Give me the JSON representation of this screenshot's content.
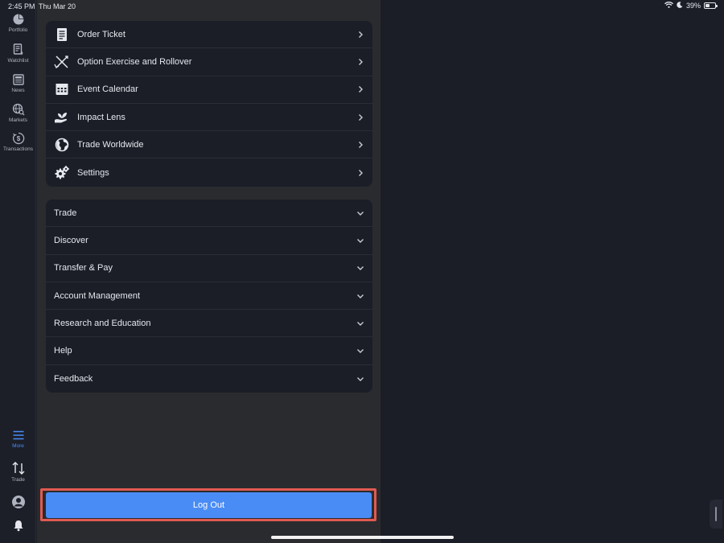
{
  "status_bar": {
    "time": "2:45 PM",
    "date": "Thu Mar 20",
    "battery": "39%",
    "icons": [
      "wifi-icon",
      "moon-icon",
      "battery-icon"
    ]
  },
  "nav": {
    "items": [
      {
        "label": "Portfolio",
        "icon": "pie-chart-icon"
      },
      {
        "label": "Watchlist",
        "icon": "watchlist-icon"
      },
      {
        "label": "News",
        "icon": "news-icon"
      },
      {
        "label": "Markets",
        "icon": "globe-search-icon"
      },
      {
        "label": "Transactions",
        "icon": "dollar-clock-icon"
      }
    ],
    "bottom": [
      {
        "label": "More",
        "icon": "menu-icon",
        "active": true
      },
      {
        "label": "Trade",
        "icon": "arrows-up-down-icon"
      },
      {
        "label": "",
        "icon": "user-icon"
      },
      {
        "label": "",
        "icon": "bell-icon"
      }
    ],
    "accent_color": "#4a8cf5"
  },
  "tools": [
    {
      "label": "Order Ticket",
      "icon": "order-ticket-icon"
    },
    {
      "label": "Option Exercise and Rollover",
      "icon": "option-exercise-icon"
    },
    {
      "label": "Event Calendar",
      "icon": "calendar-icon"
    },
    {
      "label": "Impact Lens",
      "icon": "impact-lens-icon"
    },
    {
      "label": "Trade Worldwide",
      "icon": "globe-icon"
    },
    {
      "label": "Settings",
      "icon": "gear-icon"
    }
  ],
  "sections": [
    {
      "label": "Trade"
    },
    {
      "label": "Discover"
    },
    {
      "label": "Transfer & Pay"
    },
    {
      "label": "Account Management"
    },
    {
      "label": "Research and Education"
    },
    {
      "label": "Help"
    },
    {
      "label": "Feedback"
    }
  ],
  "logout": {
    "label": "Log Out",
    "color": "#4a8cf5",
    "highlight_color": "#e05a52"
  }
}
